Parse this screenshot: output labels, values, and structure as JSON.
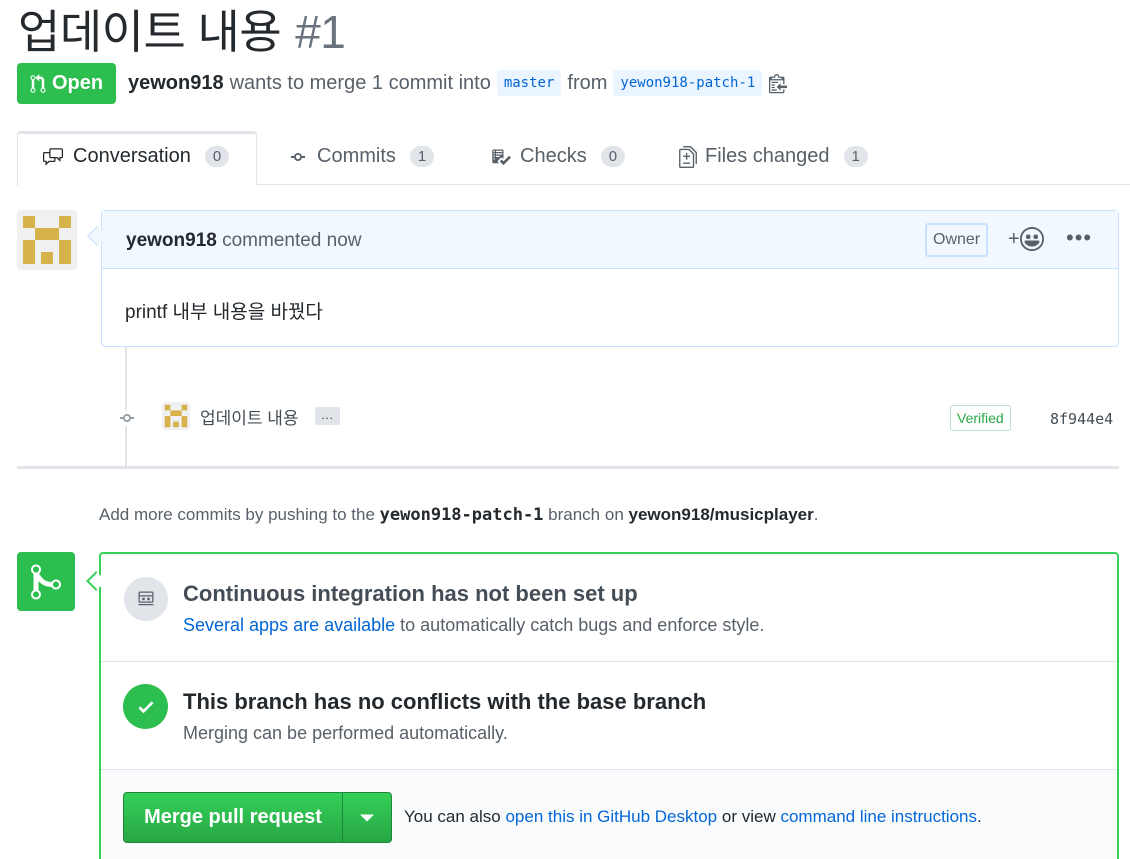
{
  "pr": {
    "title": "업데이트 내용",
    "number": "#1",
    "state": "Open",
    "author": "yewon918",
    "meta_text": "wants to merge 1 commit into",
    "base_branch": "master",
    "from_text": "from",
    "head_branch": "yewon918-patch-1"
  },
  "tabs": [
    {
      "label": "Conversation",
      "count": "0",
      "icon": "comment-discussion-icon"
    },
    {
      "label": "Commits",
      "count": "1",
      "icon": "git-commit-icon"
    },
    {
      "label": "Checks",
      "count": "0",
      "icon": "checklist-icon"
    },
    {
      "label": "Files changed",
      "count": "1",
      "icon": "diff-icon"
    }
  ],
  "comment": {
    "author": "yewon918",
    "action": "commented now",
    "badge": "Owner",
    "reaction_symbol": "+",
    "more": "•••",
    "body": "printf 내부 내용을 바꿨다"
  },
  "commit": {
    "message": "업데이트 내용",
    "ellipsis": "…",
    "verified": "Verified",
    "sha": "8f944e4"
  },
  "hint": {
    "prefix": "Add more commits by pushing to the",
    "branch": "yewon918-patch-1",
    "middle": "branch on",
    "repo": "yewon918/musicplayer",
    "suffix": "."
  },
  "merge": {
    "ci_title": "Continuous integration has not been set up",
    "ci_link": "Several apps are available",
    "ci_rest": "to automatically catch bugs and enforce style.",
    "ok_title": "This branch has no conflicts with the base branch",
    "ok_sub": "Merging can be performed automatically.",
    "button": "Merge pull request",
    "also_prefix": "You can also",
    "also_link1": "open this in GitHub Desktop",
    "also_middle": "or view",
    "also_link2": "command line instructions",
    "also_suffix": "."
  },
  "colors": {
    "green": "#2cbe4e",
    "link": "#0366d6",
    "branch_bg": "#eaf5ff"
  }
}
